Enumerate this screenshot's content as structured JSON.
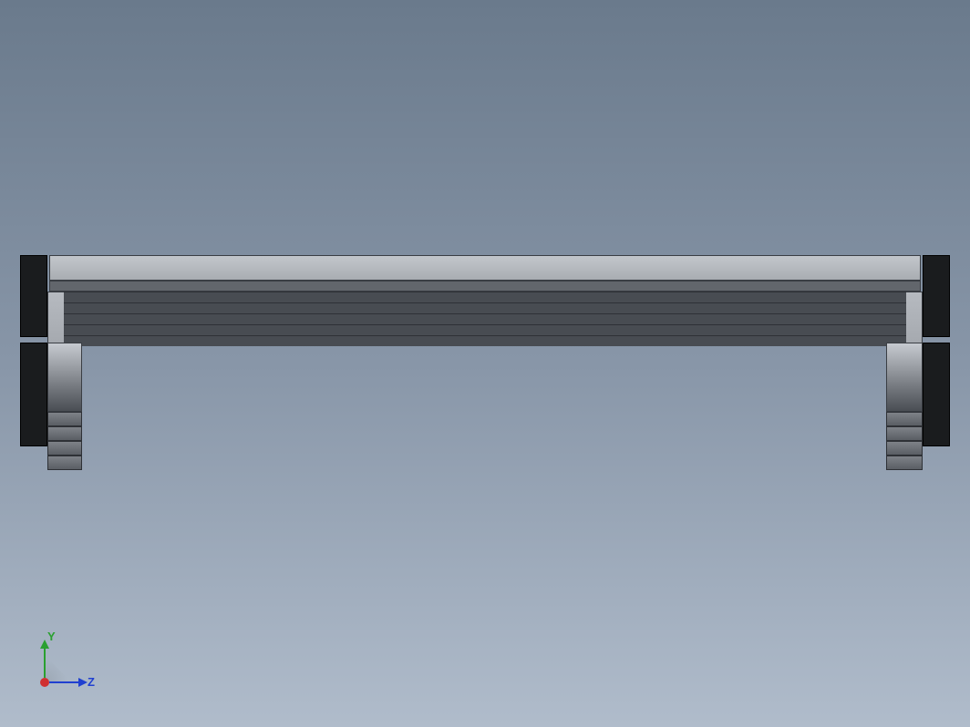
{
  "axes": {
    "y_label": "Y",
    "z_label": "Z"
  },
  "colors": {
    "axis_x_origin": "#d03030",
    "axis_y": "#2aa030",
    "axis_z": "#2040d0"
  }
}
